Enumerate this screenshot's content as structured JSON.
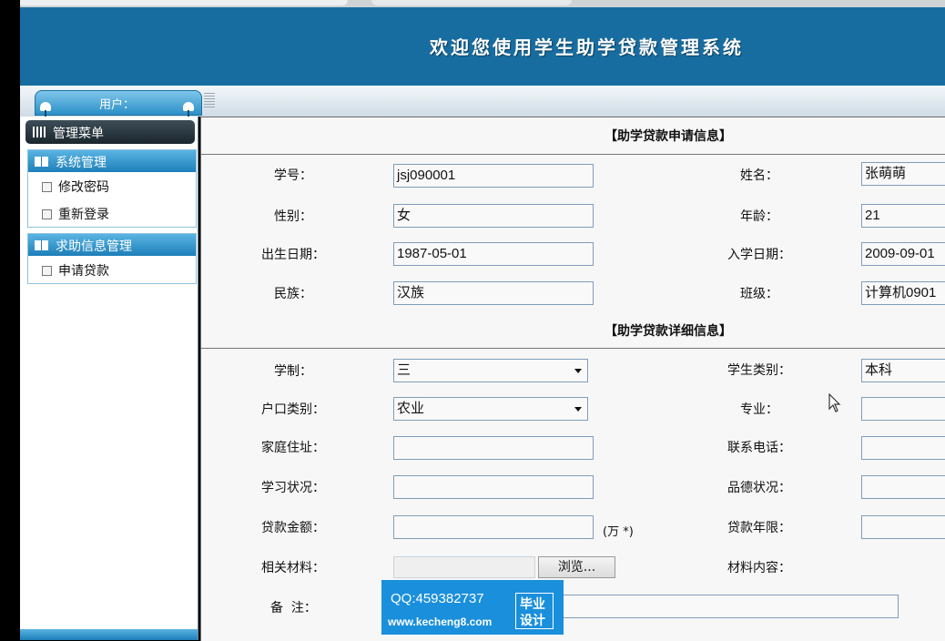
{
  "header": {
    "title": "欢迎您使用学生助学贷款管理系统",
    "user_label": "用户："
  },
  "sidebar": {
    "menu_title": "管理菜单",
    "groups": [
      {
        "title": "系统管理",
        "items": [
          "修改密码",
          "重新登录"
        ]
      },
      {
        "title": "求助信息管理",
        "items": [
          "申请贷款"
        ]
      }
    ]
  },
  "section1": {
    "heading": "【助学贷款申请信息】",
    "student_id": {
      "label": "学号：",
      "value": "jsj090001"
    },
    "name": {
      "label": "姓名：",
      "value": "张萌萌"
    },
    "gender": {
      "label": "性别：",
      "value": "女"
    },
    "age": {
      "label": "年龄：",
      "value": "21"
    },
    "birth_date": {
      "label": "出生日期：",
      "value": "1987-05-01"
    },
    "enroll_date": {
      "label": "入学日期：",
      "value": "2009-09-01"
    },
    "ethnicity": {
      "label": "民族：",
      "value": "汉族"
    },
    "class": {
      "label": "班级：",
      "value": "计算机0901"
    }
  },
  "section2": {
    "heading": "【助学贷款详细信息】",
    "schooling": {
      "label": "学制：",
      "value": "三"
    },
    "student_type": {
      "label": "学生类别：",
      "value": "本科"
    },
    "household": {
      "label": "户口类别：",
      "value": "农业"
    },
    "major": {
      "label": "专业：",
      "value": ""
    },
    "address": {
      "label": "家庭住址：",
      "value": ""
    },
    "phone": {
      "label": "联系电话：",
      "value": ""
    },
    "study_status": {
      "label": "学习状况：",
      "value": ""
    },
    "moral_status": {
      "label": "品德状况：",
      "value": ""
    },
    "loan_amount": {
      "label": "贷款金额：",
      "value": "",
      "unit": "(万 *)"
    },
    "loan_years": {
      "label": "贷款年限：",
      "value": ""
    },
    "materials": {
      "label": "相关材料：",
      "browse": "浏览..."
    },
    "material_content": {
      "label": "材料内容："
    },
    "remarks": {
      "label": "备  注：",
      "value": ""
    }
  },
  "watermark": {
    "qq": "QQ:459382737",
    "url": "www.kecheng8.com",
    "tag1": "毕业",
    "tag2": "设计"
  },
  "colors": {
    "header": "#186da0",
    "accent": "#1d7fb8",
    "watermark": "#1a8fdc"
  }
}
